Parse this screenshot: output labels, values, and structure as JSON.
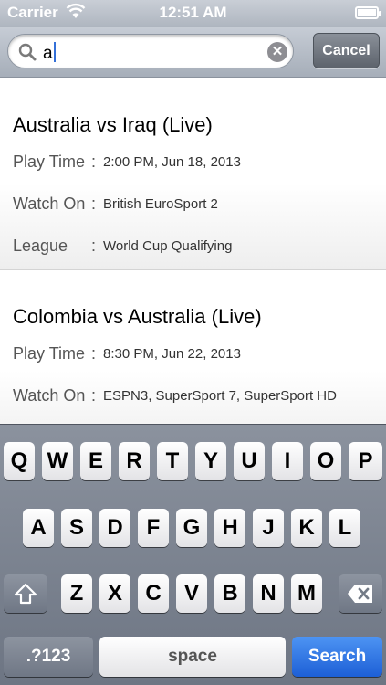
{
  "status_bar": {
    "carrier": "Carrier",
    "time": "12:51 AM",
    "battery_level": 1.0
  },
  "search": {
    "value": "a",
    "cancel_label": "Cancel",
    "clear_label": "✕"
  },
  "matches": [
    {
      "title": "Australia vs Iraq (Live)",
      "rows": [
        {
          "label": "Play Time",
          "value": "2:00 PM, Jun 18, 2013"
        },
        {
          "label": "Watch On",
          "value": "British EuroSport 2"
        },
        {
          "label": "League",
          "value": "World Cup Qualifying"
        }
      ]
    },
    {
      "title": "Colombia vs Australia (Live)",
      "rows": [
        {
          "label": "Play Time",
          "value": "8:30 PM, Jun 22, 2013"
        },
        {
          "label": "Watch On",
          "value": "ESPN3, SuperSport 7, SuperSport HD"
        }
      ]
    }
  ],
  "keyboard": {
    "row1": [
      "Q",
      "W",
      "E",
      "R",
      "T",
      "Y",
      "U",
      "I",
      "O",
      "P"
    ],
    "row2": [
      "A",
      "S",
      "D",
      "F",
      "G",
      "H",
      "J",
      "K",
      "L"
    ],
    "row3": [
      "Z",
      "X",
      "C",
      "V",
      "B",
      "N",
      "M"
    ],
    "numbers_label": ".?123",
    "space_label": "space",
    "search_label": "Search",
    "shift_icon": "shift-icon",
    "delete_icon": "delete-icon"
  },
  "colors": {
    "accent_blue": "#1d5fd6",
    "caret": "#3470d8"
  }
}
